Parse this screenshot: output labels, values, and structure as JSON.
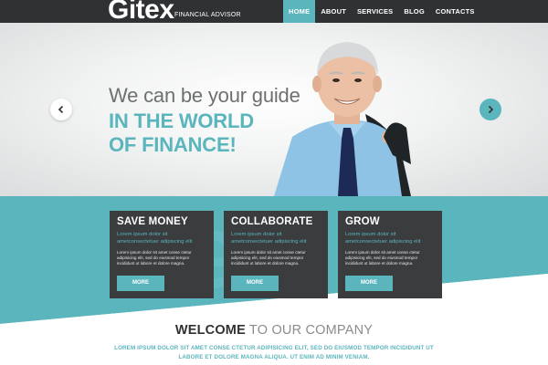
{
  "brand": {
    "logo": "Gitex",
    "tagline": "FINANCIAL ADVISOR"
  },
  "nav": {
    "items": [
      {
        "label": "HOME",
        "active": true
      },
      {
        "label": "ABOUT",
        "active": false
      },
      {
        "label": "SERVICES",
        "active": false
      },
      {
        "label": "BLOG",
        "active": false
      },
      {
        "label": "CONTACTS",
        "active": false
      }
    ]
  },
  "hero": {
    "line1": "We can be your guide",
    "line2": "IN THE WORLD",
    "line3": "OF FINANCE!",
    "prev_icon": "chevron-left-icon",
    "next_icon": "chevron-right-icon"
  },
  "cards": [
    {
      "title": "SAVE MONEY",
      "subtitle": "Lorem ipsum dolor sit ametconsectetuer adipiscing elit",
      "body": "Lorem ipsum dolor sit amet conse ctetur adipisicing elit, sed do eiusmod tempor incididunt ut labore et dolore magna.",
      "button": "MORE"
    },
    {
      "title": "COLLABORATE",
      "subtitle": "Lorem ipsum dolor sit ametconsectetuer adipiscing elit",
      "body": "Lorem ipsum dolor sit amet conse ctetur adipisicing elit, sed do eiusmod tempor incididunt ut labore et dolore magna.",
      "button": "MORE"
    },
    {
      "title": "GROW",
      "subtitle": "Lorem ipsum dolor sit ametconsectetuer adipiscing elit",
      "body": "Lorem ipsum dolor sit amet conse ctetur adipisicing elit, sed do eiusmod tempor incididunt ut labore et dolore magna.",
      "button": "MORE"
    }
  ],
  "welcome": {
    "strong": "WELCOME",
    "light": " TO OUR COMPANY",
    "text": "LOREM IPSUM DOLOR SIT AMET CONSE CTETUR ADIPISICING ELIT, SED DO EIUSMOD TEMPOR INCIDIDUNT UT LABORE ET DOLORE MAGNA ALIQUA. UT ENIM AD MINIM VENIAM."
  },
  "colors": {
    "accent": "#5bb5bd",
    "dark": "#2f3133",
    "card": "#3a3c3e"
  }
}
